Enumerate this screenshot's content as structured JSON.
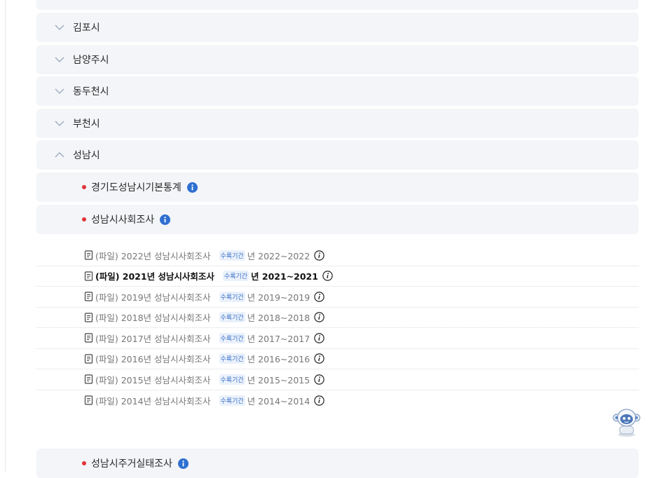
{
  "regions": [
    {
      "label": "김포시",
      "expanded": false
    },
    {
      "label": "남양주시",
      "expanded": false
    },
    {
      "label": "동두천시",
      "expanded": false
    },
    {
      "label": "부천시",
      "expanded": false
    },
    {
      "label": "성남시",
      "expanded": true
    }
  ],
  "statistics": [
    {
      "label": "경기도성남시기본통계"
    },
    {
      "label": "성남시사회조사"
    },
    {
      "label": "성남시주거실태조사"
    }
  ],
  "files": [
    {
      "title": "(파일) 2022년 성남시사회조사",
      "badge": "수록기간",
      "period": "년 2022~2022",
      "active": false
    },
    {
      "title": "(파일) 2021년 성남시사회조사",
      "badge": "수록기간",
      "period": "년 2021~2021",
      "active": true
    },
    {
      "title": "(파일) 2019년 성남시사회조사",
      "badge": "수록기간",
      "period": "년 2019~2019",
      "active": false
    },
    {
      "title": "(파일) 2018년 성남시사회조사",
      "badge": "수록기간",
      "period": "년 2018~2018",
      "active": false
    },
    {
      "title": "(파일) 2017년 성남시사회조사",
      "badge": "수록기간",
      "period": "년 2017~2017",
      "active": false
    },
    {
      "title": "(파일) 2016년 성남시사회조사",
      "badge": "수록기간",
      "period": "년 2016~2016",
      "active": false
    },
    {
      "title": "(파일) 2015년 성남시사회조사",
      "badge": "수록기간",
      "period": "년 2015~2015",
      "active": false
    },
    {
      "title": "(파일) 2014년 성남시사회조사",
      "badge": "수록기간",
      "period": "년 2014~2014",
      "active": false
    }
  ],
  "colors": {
    "accent_dot": "#e2333a",
    "info_icon": "#2f6fd1",
    "bar_bg": "#f3f5f8"
  }
}
